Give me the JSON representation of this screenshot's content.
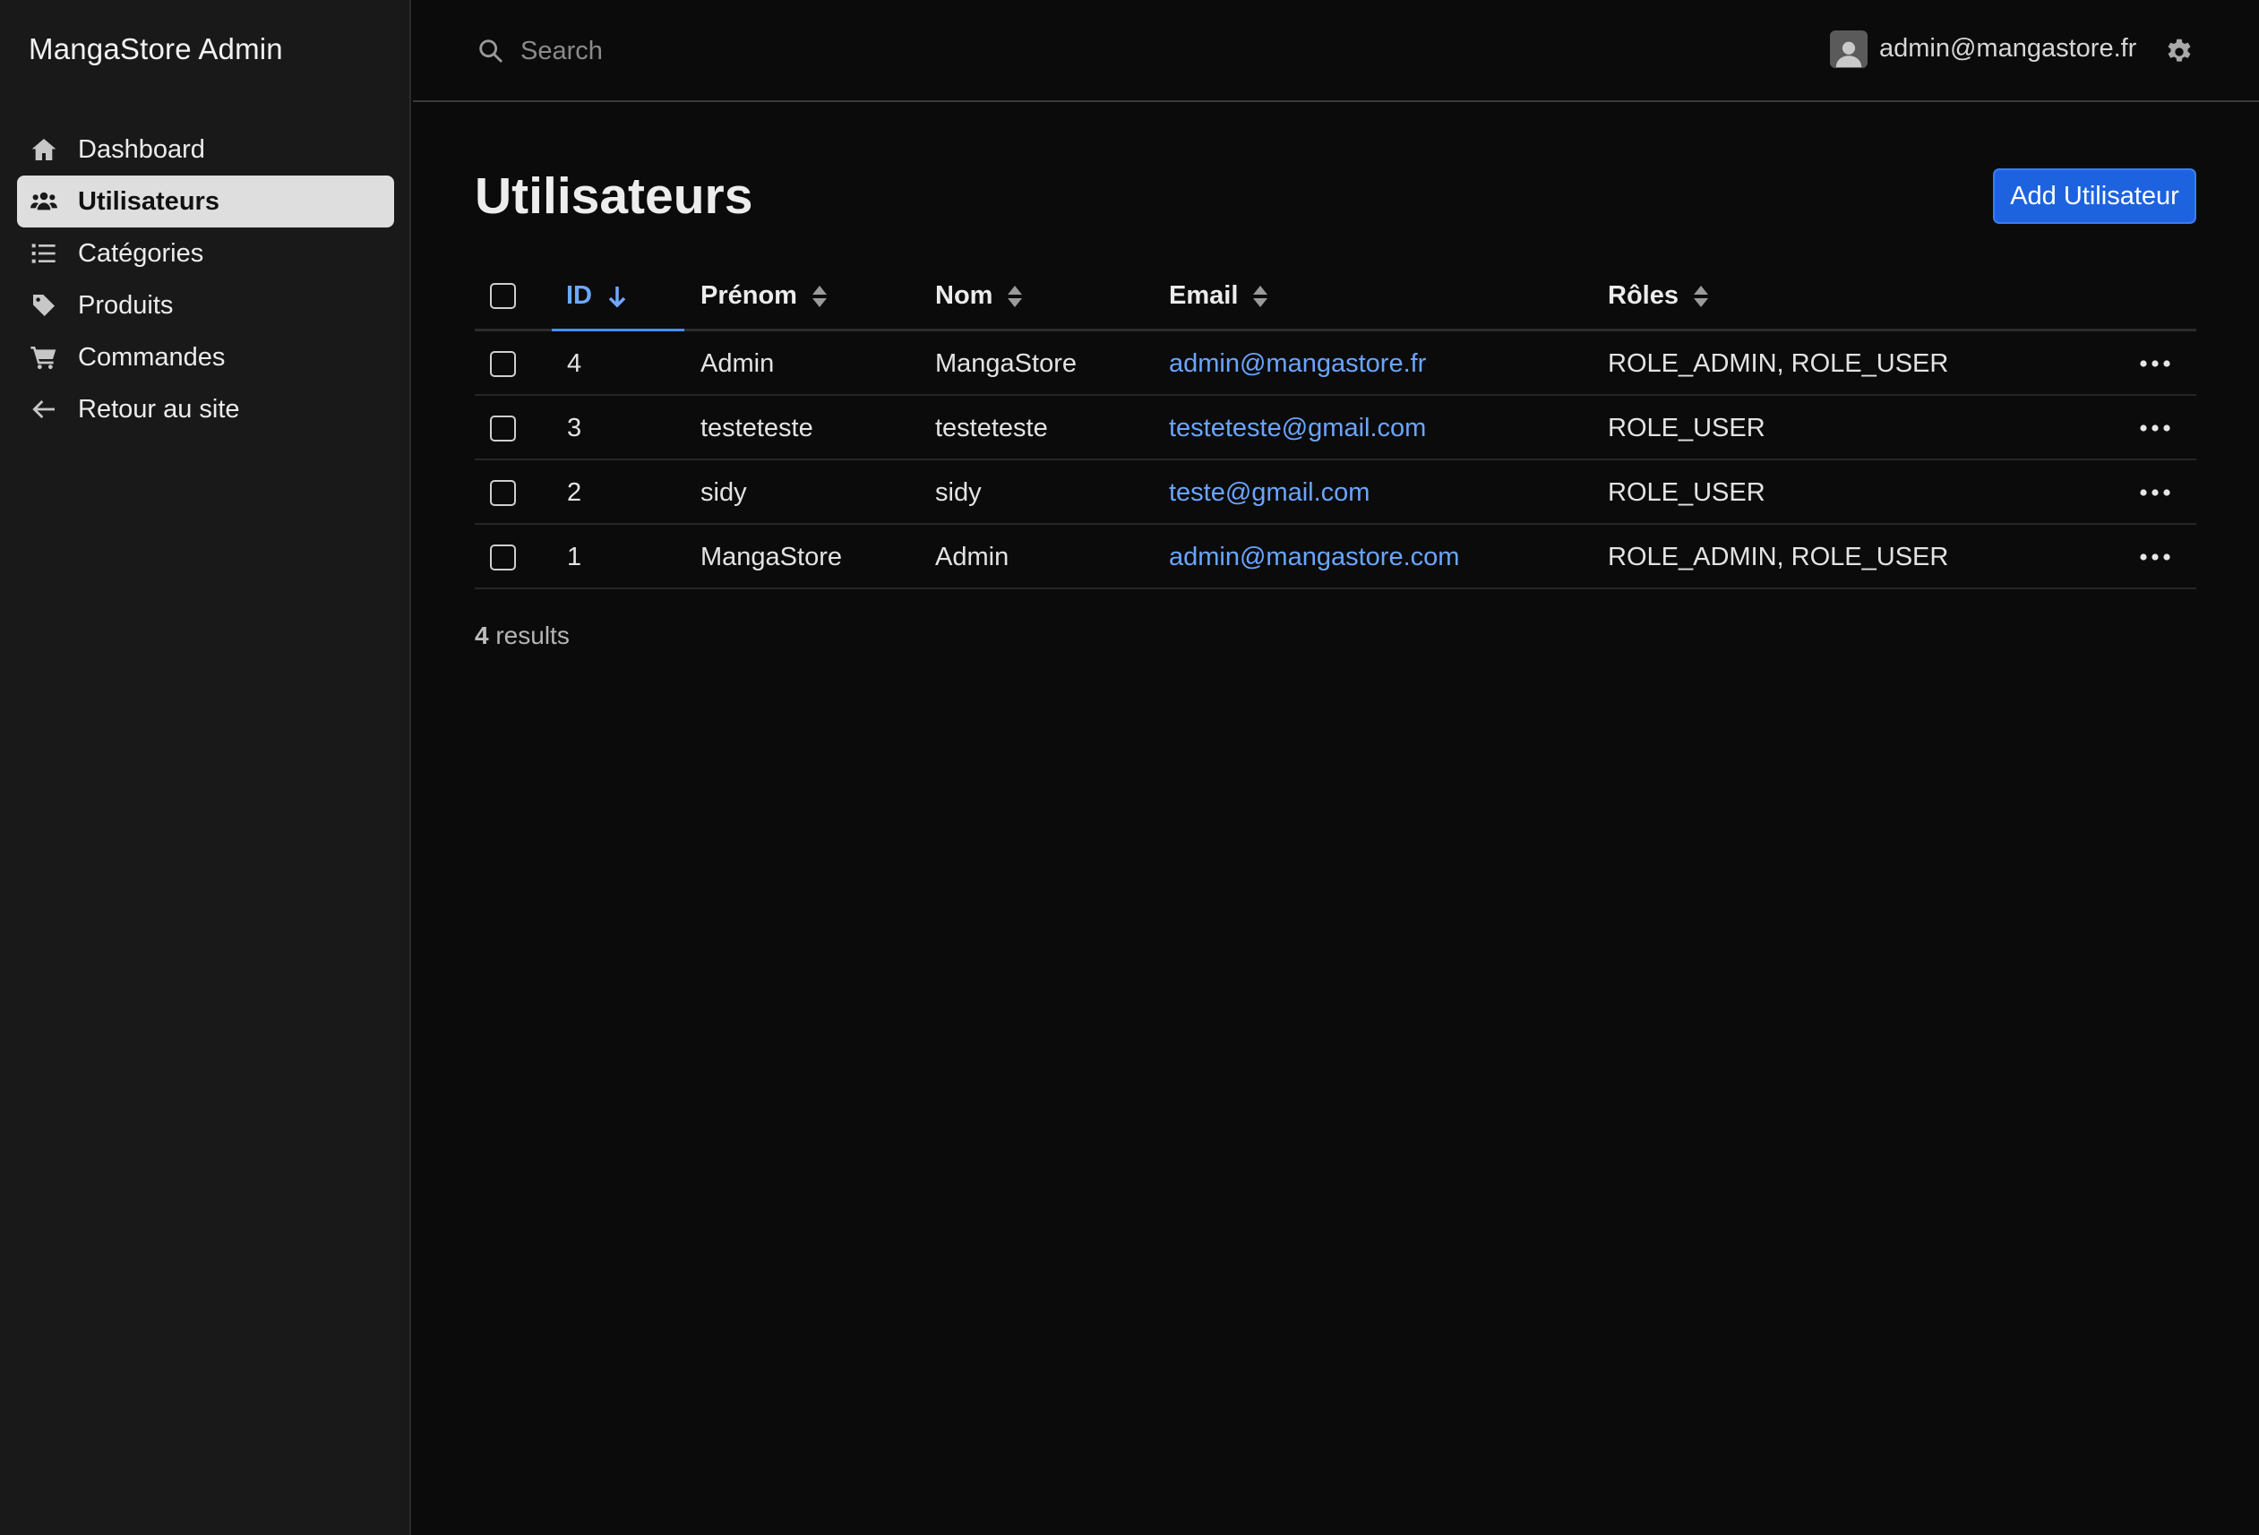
{
  "sidebar": {
    "brand": "MangaStore Admin",
    "items": [
      {
        "label": "Dashboard",
        "icon": "home-icon",
        "active": false
      },
      {
        "label": "Utilisateurs",
        "icon": "users-icon",
        "active": true
      },
      {
        "label": "Catégories",
        "icon": "list-icon",
        "active": false
      },
      {
        "label": "Produits",
        "icon": "tag-icon",
        "active": false
      },
      {
        "label": "Commandes",
        "icon": "cart-icon",
        "active": false
      },
      {
        "label": "Retour au site",
        "icon": "arrow-left-icon",
        "active": false
      }
    ]
  },
  "header": {
    "search_placeholder": "Search",
    "search_value": "",
    "user_email": "admin@mangastore.fr"
  },
  "main": {
    "title": "Utilisateurs",
    "add_button_label": "Add Utilisateur",
    "columns": [
      {
        "label": "ID",
        "sort": "desc"
      },
      {
        "label": "Prénom",
        "sort": "none"
      },
      {
        "label": "Nom",
        "sort": "none"
      },
      {
        "label": "Email",
        "sort": "none"
      },
      {
        "label": "Rôles",
        "sort": "none"
      }
    ],
    "rows": [
      {
        "id": "4",
        "prenom": "Admin",
        "nom": "MangaStore",
        "email": "admin@mangastore.fr",
        "roles": "ROLE_ADMIN, ROLE_USER"
      },
      {
        "id": "3",
        "prenom": "testeteste",
        "nom": "testeteste",
        "email": "testeteste@gmail.com",
        "roles": "ROLE_USER"
      },
      {
        "id": "2",
        "prenom": "sidy",
        "nom": "sidy",
        "email": "teste@gmail.com",
        "roles": "ROLE_USER"
      },
      {
        "id": "1",
        "prenom": "MangaStore",
        "nom": "Admin",
        "email": "admin@mangastore.com",
        "roles": "ROLE_ADMIN, ROLE_USER"
      }
    ],
    "results_count": "4",
    "results_label": "results"
  },
  "colors": {
    "accent": "#1d63e0",
    "link": "#6aa5ff",
    "background": "#0b0b0b",
    "sidebar": "#191919"
  }
}
